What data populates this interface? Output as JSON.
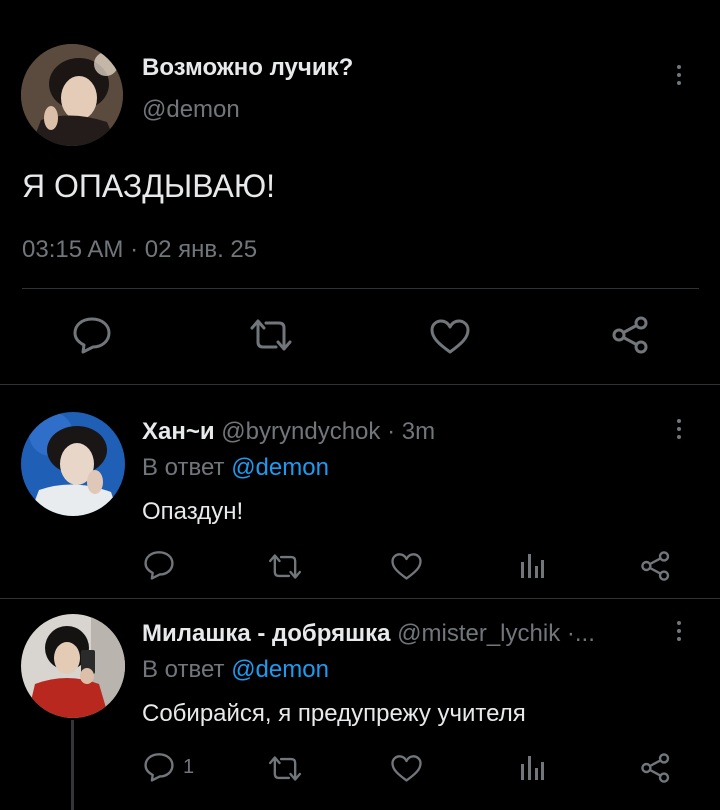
{
  "main_tweet": {
    "display_name": "Возможно лучик?",
    "handle": "@demon",
    "text": "Я ОПАЗДЫВАЮ!",
    "timestamp": "03:15 AM · 02 янв. 25"
  },
  "replies": [
    {
      "display_name": "Хан~и",
      "handle": "@byryndychok",
      "time": "· 3m",
      "reply_prefix": "В ответ",
      "reply_to": "@demon",
      "text": "Опаздун!",
      "reply_count": ""
    },
    {
      "display_name": "Милашка - добряшка",
      "handle": "@mister_lychik",
      "time": "·...",
      "reply_prefix": "В ответ",
      "reply_to": "@demon",
      "text": "Собирайся, я предупрежу учителя",
      "reply_count": "1"
    }
  ],
  "icons": [
    "reply-icon",
    "retweet-icon",
    "like-icon",
    "views-icon",
    "share-icon",
    "more-icon"
  ],
  "colors": {
    "background": "#000000",
    "text": "#e7e9ea",
    "muted": "#71767b",
    "accent": "#1d9bf0",
    "divider": "#2f3336"
  }
}
